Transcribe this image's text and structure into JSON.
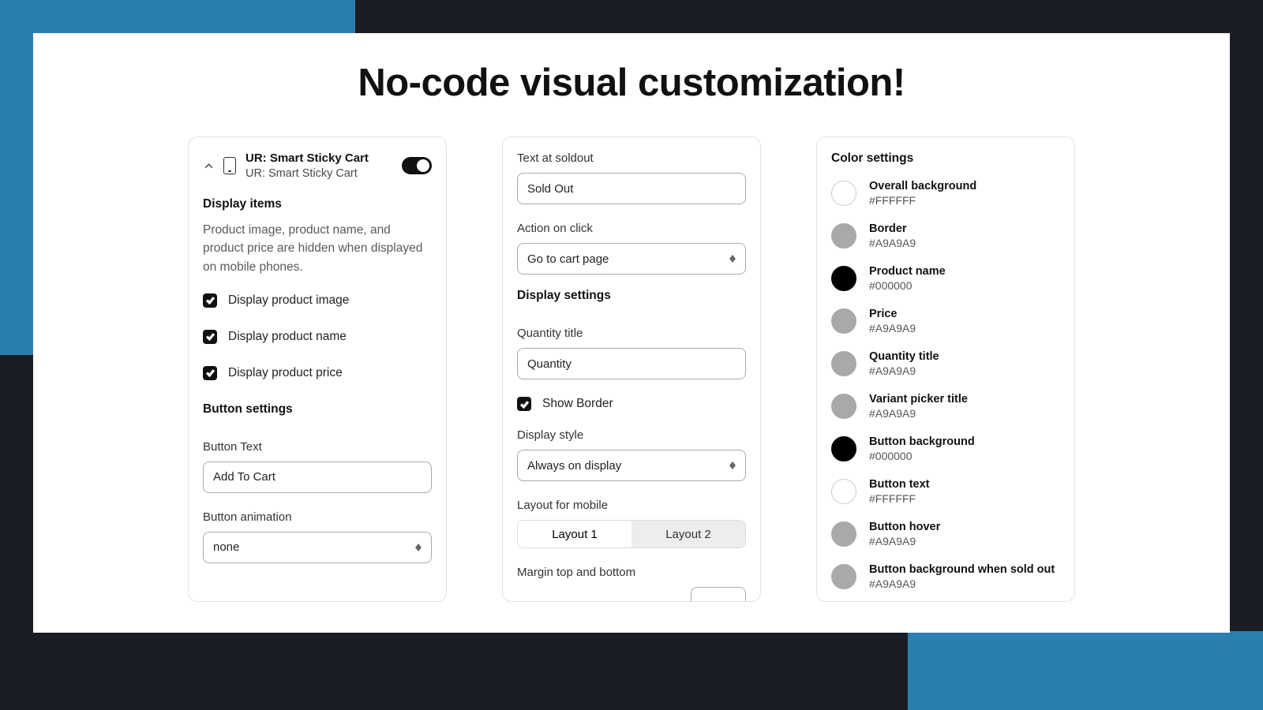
{
  "hero": "No-code visual customization!",
  "card1": {
    "title": "UR: Smart Sticky Cart",
    "subtitle": "UR: Smart Sticky Cart",
    "displayItemsHeading": "Display items",
    "description": "Product image, product name, and product price are hidden when displayed on mobile phones.",
    "cb1": "Display product image",
    "cb2": "Display product name",
    "cb3": "Display product price",
    "buttonSettings": "Button settings",
    "buttonTextLabel": "Button Text",
    "buttonTextValue": "Add To Cart",
    "buttonAnimLabel": "Button animation",
    "buttonAnimValue": "none"
  },
  "card2": {
    "soldoutLabel": "Text at soldout",
    "soldoutValue": "Sold Out",
    "actionLabel": "Action on click",
    "actionValue": "Go to cart page",
    "displaySettings": "Display settings",
    "qtyTitleLabel": "Quantity title",
    "qtyTitleValue": "Quantity",
    "showBorder": "Show Border",
    "displayStyleLabel": "Display style",
    "displayStyleValue": "Always on display",
    "layoutLabel": "Layout for mobile",
    "layout1": "Layout 1",
    "layout2": "Layout 2",
    "marginLabel": "Margin top and bottom"
  },
  "card3": {
    "heading": "Color settings",
    "rows": [
      {
        "name": "Overall background",
        "hex": "#FFFFFF",
        "swatch": "#FFFFFF"
      },
      {
        "name": "Border",
        "hex": "#A9A9A9",
        "swatch": "#A9A9A9"
      },
      {
        "name": "Product name",
        "hex": "#000000",
        "swatch": "#000000"
      },
      {
        "name": "Price",
        "hex": "#A9A9A9",
        "swatch": "#A9A9A9"
      },
      {
        "name": "Quantity title",
        "hex": "#A9A9A9",
        "swatch": "#A9A9A9"
      },
      {
        "name": "Variant picker title",
        "hex": "#A9A9A9",
        "swatch": "#A9A9A9"
      },
      {
        "name": "Button background",
        "hex": "#000000",
        "swatch": "#000000"
      },
      {
        "name": "Button text",
        "hex": "#FFFFFF",
        "swatch": "#FFFFFF"
      },
      {
        "name": "Button hover",
        "hex": "#A9A9A9",
        "swatch": "#A9A9A9"
      },
      {
        "name": "Button background when sold out",
        "hex": "#A9A9A9",
        "swatch": "#A9A9A9"
      }
    ]
  }
}
